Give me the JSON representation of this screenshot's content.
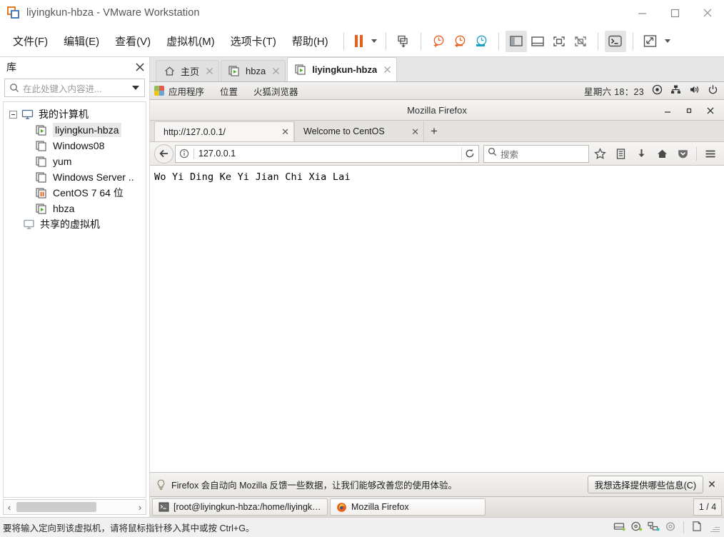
{
  "window": {
    "title": "liyingkun-hbza - VMware Workstation",
    "controls": {
      "minimize": "–",
      "maximize": "□",
      "close": "✕"
    }
  },
  "menubar": {
    "items": [
      {
        "label": "文件(F)",
        "name": "menu-file"
      },
      {
        "label": "编辑(E)",
        "name": "menu-edit"
      },
      {
        "label": "查看(V)",
        "name": "menu-view"
      },
      {
        "label": "虚拟机(M)",
        "name": "menu-vm"
      },
      {
        "label": "选项卡(T)",
        "name": "menu-tabs"
      },
      {
        "label": "帮助(H)",
        "name": "menu-help"
      }
    ]
  },
  "library": {
    "title": "库",
    "search_placeholder": "在此处键入内容进...",
    "tree": [
      {
        "label": "我的计算机",
        "level": 0,
        "icon": "computer-icon",
        "state": "root",
        "selected": false
      },
      {
        "label": "liyingkun-hbza",
        "level": 1,
        "icon": "vm-running-icon",
        "state": "running",
        "selected": true
      },
      {
        "label": "Windows08",
        "level": 1,
        "icon": "vm-stopped-icon",
        "state": "stopped",
        "selected": false
      },
      {
        "label": "yum",
        "level": 1,
        "icon": "vm-stopped-icon",
        "state": "stopped",
        "selected": false
      },
      {
        "label": "Windows Server ..",
        "level": 1,
        "icon": "vm-stopped-icon",
        "state": "stopped",
        "selected": false
      },
      {
        "label": "CentOS 7 64 位",
        "level": 1,
        "icon": "vm-suspended-icon",
        "state": "suspended",
        "selected": false
      },
      {
        "label": "hbza",
        "level": 1,
        "icon": "vm-running-icon",
        "state": "running",
        "selected": false
      },
      {
        "label": "共享的虚拟机",
        "level": 0,
        "icon": "shared-vm-icon",
        "state": "shared",
        "selected": false
      }
    ]
  },
  "vm_tabs": [
    {
      "label": "主页",
      "icon": "home-icon",
      "active": false
    },
    {
      "label": "hbza",
      "icon": "vm-running-icon",
      "active": false
    },
    {
      "label": "liyingkun-hbza",
      "icon": "vm-running-icon",
      "active": true
    }
  ],
  "guest": {
    "gnome_top": {
      "applications": "应用程序",
      "places": "位置",
      "current_app": "火狐浏览器",
      "clock": "星期六 18：23",
      "icons": [
        "network-target-icon",
        "network-icon",
        "volume-icon",
        "power-icon"
      ]
    },
    "firefox": {
      "window_title": "Mozilla Firefox",
      "tabs": [
        {
          "label": "http://127.0.0.1/",
          "active": true
        },
        {
          "label": "Welcome to CentOS",
          "active": false
        }
      ],
      "new_tab_label": "+",
      "url_value": "127.0.0.1",
      "search_placeholder": "搜索",
      "toolbar_icons": [
        "bookmark-star-icon",
        "library-icon",
        "download-icon",
        "home-icon",
        "pocket-icon",
        "hamburger-menu-icon"
      ],
      "page_content": "Wo Yi Ding Ke Yi Jian Chi Xia Lai",
      "notification": {
        "message": "Firefox 会自动向 Mozilla 反馈一些数据，让我们能够改善您的使用体验。",
        "button_label": "我想选择提供哪些信息(C)",
        "close_label": "✕"
      }
    },
    "taskbar": {
      "items": [
        {
          "label": "[root@liyingkun-hbza:/home/liyingk…",
          "icon": "terminal-icon",
          "active": false
        },
        {
          "label": "Mozilla Firefox",
          "icon": "firefox-icon",
          "active": true
        }
      ],
      "workspace": "1 / 4"
    }
  },
  "statusbar": {
    "message": "要将输入定向到该虚拟机，请将鼠标指针移入其中或按 Ctrl+G。",
    "icons": [
      "hard-disk-icon",
      "cd-dvd-icon",
      "network-adapter-icon",
      "usb-icon",
      "printer-icon"
    ]
  },
  "colors": {
    "accent_orange": "#e8601c",
    "accent_blue": "#1ba1c4",
    "vm_running_green": "#4caf2a",
    "chrome_bg": "#f0f0f0"
  }
}
